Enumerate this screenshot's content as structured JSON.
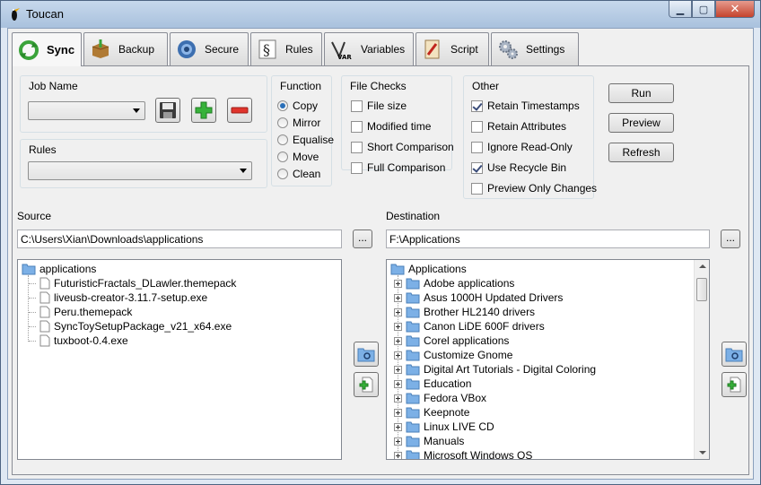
{
  "app": {
    "title": "Toucan"
  },
  "tabs": [
    {
      "label": "Sync",
      "icon": "sync-icon",
      "active": true
    },
    {
      "label": "Backup",
      "icon": "box-icon"
    },
    {
      "label": "Secure",
      "icon": "shield-icon"
    },
    {
      "label": "Rules",
      "icon": "section-sign-icon"
    },
    {
      "label": "Variables",
      "icon": "var-icon"
    },
    {
      "label": "Script",
      "icon": "script-icon"
    },
    {
      "label": "Settings",
      "icon": "gears-icon"
    }
  ],
  "job": {
    "label": "Job Name",
    "value": ""
  },
  "rules": {
    "label": "Rules",
    "value": ""
  },
  "function_group": {
    "label": "Function",
    "options": [
      "Copy",
      "Mirror",
      "Equalise",
      "Move",
      "Clean"
    ],
    "selected": "Copy"
  },
  "file_checks": {
    "label": "File Checks",
    "options": [
      {
        "label": "File size",
        "checked": false
      },
      {
        "label": "Modified time",
        "checked": false
      },
      {
        "label": "Short Comparison",
        "checked": false
      },
      {
        "label": "Full Comparison",
        "checked": false
      }
    ]
  },
  "other": {
    "label": "Other",
    "options": [
      {
        "label": "Retain Timestamps",
        "checked": true
      },
      {
        "label": "Retain Attributes",
        "checked": false
      },
      {
        "label": "Ignore Read-Only",
        "checked": false
      },
      {
        "label": "Use Recycle Bin",
        "checked": true
      },
      {
        "label": "Preview Only Changes",
        "checked": false
      }
    ]
  },
  "actions": {
    "run": "Run",
    "preview": "Preview",
    "refresh": "Refresh"
  },
  "source": {
    "label": "Source",
    "path": "C:\\Users\\Xian\\Downloads\\applications",
    "browse": "...",
    "root": "applications",
    "files": [
      "FuturisticFractals_DLawler.themepack",
      "liveusb-creator-3.11.7-setup.exe",
      "Peru.themepack",
      "SyncToySetupPackage_v21_x64.exe",
      "tuxboot-0.4.exe"
    ]
  },
  "destination": {
    "label": "Destination",
    "path": "F:\\Applications",
    "browse": "...",
    "root": "Applications",
    "folders": [
      "Adobe applications",
      "Asus 1000H Updated Drivers",
      "Brother HL2140 drivers",
      "Canon LiDE 600F drivers",
      "Corel applications",
      "Customize Gnome",
      "Digital Art Tutorials - Digital Coloring",
      "Education",
      "Fedora VBox",
      "Keepnote",
      "Linux LIVE CD",
      "Manuals",
      "Microsoft Windows OS"
    ]
  }
}
